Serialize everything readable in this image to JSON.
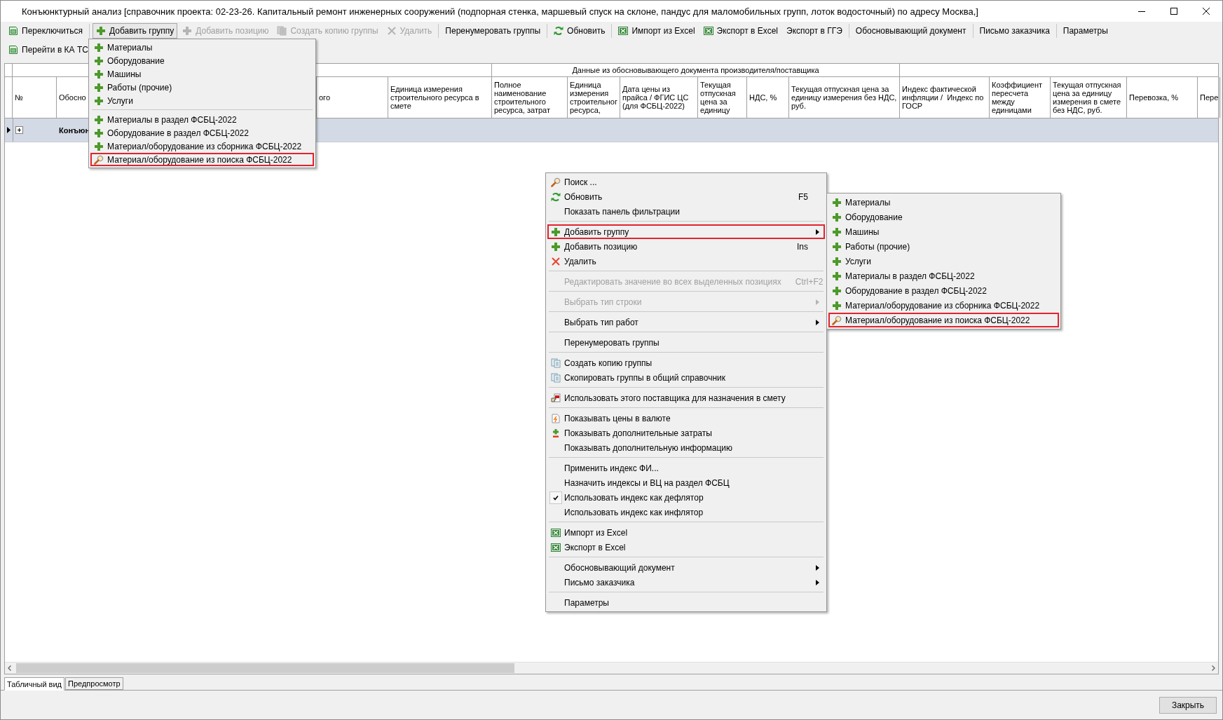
{
  "window": {
    "title": "Конъюнктурный анализ [справочник проекта: 02-23-26. Капитальный ремонт инженерных сооружений (подпорная стенка, маршевый спуск на склоне, пандус для маломобильных групп, лоток водосточный) по адресу Москва,]"
  },
  "toolbar": {
    "rows": [
      {
        "groups": [
          [
            {
              "label": "Переключиться",
              "disabled": false,
              "pressed": false
            }
          ],
          [
            {
              "label": "Добавить группу",
              "disabled": false,
              "pressed": true
            },
            {
              "label": "Добавить позицию",
              "disabled": true,
              "pressed": false
            },
            {
              "label": "Создать копию группы",
              "disabled": true,
              "pressed": false
            },
            {
              "label": "Удалить",
              "disabled": true,
              "pressed": false
            }
          ],
          [
            {
              "label": "Перенумеровать группы",
              "disabled": false,
              "pressed": false
            }
          ],
          [
            {
              "label": "Обновить",
              "disabled": false,
              "pressed": false
            }
          ],
          [
            {
              "label": "Импорт из Excel",
              "disabled": false,
              "pressed": false
            },
            {
              "label": "Экспорт в Excel",
              "disabled": false,
              "pressed": false
            },
            {
              "label": "Экспорт в ГГЭ",
              "disabled": false,
              "pressed": false
            }
          ],
          [
            {
              "label": "Обосновывающий документ",
              "disabled": false,
              "pressed": false
            }
          ],
          [
            {
              "label": "Письмо заказчика",
              "disabled": false,
              "pressed": false
            }
          ],
          [
            {
              "label": "Параметры",
              "disabled": false,
              "pressed": false
            }
          ]
        ]
      },
      {
        "groups": [
          [
            {
              "label": "Перейти в КА ТС",
              "disabled": false,
              "pressed": false
            }
          ]
        ]
      }
    ]
  },
  "toolbar_dropdown": {
    "groups": [
      [
        {
          "label": "Материалы",
          "highlighted": false
        },
        {
          "label": "Оборудование",
          "highlighted": false
        },
        {
          "label": "Машины",
          "highlighted": false
        },
        {
          "label": "Работы (прочие)",
          "highlighted": false
        },
        {
          "label": "Услуги",
          "highlighted": false
        }
      ],
      [
        {
          "label": "Материалы в раздел ФСБЦ-2022",
          "highlighted": false
        },
        {
          "label": "Оборудование в раздел ФСБЦ-2022",
          "highlighted": false
        },
        {
          "label": "Материал/оборудование из сборника ФСБЦ-2022",
          "highlighted": false
        },
        {
          "label": "Материал/оборудование из поиска ФСБЦ-2022",
          "highlighted": true
        }
      ]
    ]
  },
  "grid": {
    "column_group": {
      "label": "Данные из обосновывающего документа производителя/поставщика"
    },
    "columns": [
      {
        "label": "№"
      },
      {
        "label": "Обосно"
      },
      {
        "label": "ого"
      },
      {
        "label": "Единица измерения\nстроительного ресурса в\nсмете"
      },
      {
        "label": "Полное\nнаименование\nстроительного\nресурса, затрат"
      },
      {
        "label": "Единица\nизмерения\nстроительног\nресурса,"
      },
      {
        "label": "Дата цены из\nпрайса / ФГИС ЦС\n(для ФСБЦ-2022)"
      },
      {
        "label": "Текущая\nотпускная\nцена за\nединицу"
      },
      {
        "label": "НДС, %"
      },
      {
        "label": "Текущая отпускная цена за\nединицу измерения без НДС,\nруб."
      },
      {
        "label": "Индекс фактической\nинфляции /  Индекс по\nГОСР"
      },
      {
        "label": "Коэффициент\nпересчета\nмежду\nединицами"
      },
      {
        "label": "Текущая отпускная\nцена за единицу\nизмерения в смете\nбез НДС, руб."
      },
      {
        "label": "Перевозка, %"
      },
      {
        "label": "Пере"
      }
    ],
    "rows": [
      {
        "text": "Конъюн",
        "selected": true,
        "expanded": false
      }
    ]
  },
  "context_menu": {
    "groups": [
      [
        {
          "kind": "command",
          "label": "Поиск ...",
          "disabled": false,
          "highlighted": false
        },
        {
          "kind": "command",
          "label": "Обновить",
          "shortcut": "F5",
          "disabled": false,
          "highlighted": false
        },
        {
          "kind": "command",
          "label": "Показать панель фильтрации",
          "disabled": false,
          "highlighted": false
        }
      ],
      [
        {
          "kind": "command",
          "label": "Добавить группу",
          "submenu": true,
          "disabled": false,
          "highlighted": true
        },
        {
          "kind": "command",
          "label": "Добавить позицию",
          "shortcut": "Ins",
          "disabled": false,
          "highlighted": false
        },
        {
          "kind": "command",
          "label": "Удалить",
          "disabled": false,
          "highlighted": false
        }
      ],
      [
        {
          "kind": "command",
          "label": "Редактировать значение во всех выделенных позициях",
          "shortcut": "Ctrl+F2",
          "disabled": true,
          "highlighted": false
        }
      ],
      [
        {
          "kind": "command",
          "label": "Выбрать тип строки",
          "submenu": true,
          "disabled": true,
          "highlighted": false
        }
      ],
      [
        {
          "kind": "command",
          "label": "Выбрать тип работ",
          "submenu": true,
          "disabled": false,
          "highlighted": false
        }
      ],
      [
        {
          "kind": "command",
          "label": "Перенумеровать группы",
          "disabled": false,
          "highlighted": false
        }
      ],
      [
        {
          "kind": "command",
          "label": "Создать копию группы",
          "disabled": false,
          "highlighted": false
        },
        {
          "kind": "command",
          "label": "Скопировать группы в общий справочник",
          "disabled": false,
          "highlighted": false
        }
      ],
      [
        {
          "kind": "command",
          "label": "Использовать этого поставщика для назначения в смету",
          "disabled": false,
          "highlighted": false
        }
      ],
      [
        {
          "kind": "command",
          "label": "Показывать цены в валюте",
          "disabled": false,
          "highlighted": false
        },
        {
          "kind": "command",
          "label": "Показывать дополнительные затраты",
          "disabled": false,
          "highlighted": false
        },
        {
          "kind": "command",
          "label": "Показывать дополнительную информацию",
          "disabled": false,
          "highlighted": false
        }
      ],
      [
        {
          "kind": "command",
          "label": "Применить индекс ФИ...",
          "disabled": false,
          "highlighted": false
        },
        {
          "kind": "command",
          "label": "Назначить индексы и ВЦ на раздел ФСБЦ",
          "disabled": false,
          "highlighted": false
        },
        {
          "kind": "check",
          "label": "Использовать индекс как дефлятор",
          "checked": true,
          "disabled": false,
          "highlighted": false
        },
        {
          "kind": "command",
          "label": "Использовать индекс как инфлятор",
          "disabled": false,
          "highlighted": false
        }
      ],
      [
        {
          "kind": "command",
          "label": "Импорт из Excel",
          "disabled": false,
          "highlighted": false
        },
        {
          "kind": "command",
          "label": "Экспорт в Excel",
          "disabled": false,
          "highlighted": false
        }
      ],
      [
        {
          "kind": "command",
          "label": "Обосновывающий документ",
          "submenu": true,
          "disabled": false,
          "highlighted": false
        },
        {
          "kind": "command",
          "label": "Письмо заказчика",
          "submenu": true,
          "disabled": false,
          "highlighted": false
        }
      ],
      [
        {
          "kind": "command",
          "label": "Параметры",
          "disabled": false,
          "highlighted": false
        }
      ]
    ]
  },
  "submenu": {
    "groups": [
      [
        {
          "label": "Материалы",
          "highlighted": false
        },
        {
          "label": "Оборудование",
          "highlighted": false
        },
        {
          "label": "Машины",
          "highlighted": false
        },
        {
          "label": "Работы (прочие)",
          "highlighted": false
        },
        {
          "label": "Услуги",
          "highlighted": false
        },
        {
          "label": "Материалы в раздел ФСБЦ-2022",
          "highlighted": false
        },
        {
          "label": "Оборудование в раздел ФСБЦ-2022",
          "highlighted": false
        },
        {
          "label": "Материал/оборудование из сборника ФСБЦ-2022",
          "highlighted": false
        },
        {
          "label": "Материал/оборудование из поиска ФСБЦ-2022",
          "highlighted": true
        }
      ]
    ]
  },
  "view_tabs": [
    {
      "label": "Табличный вид",
      "selected": true
    },
    {
      "label": "Предпросмотр",
      "selected": false
    }
  ],
  "footer": {
    "buttons": [
      "Закрыть"
    ]
  }
}
